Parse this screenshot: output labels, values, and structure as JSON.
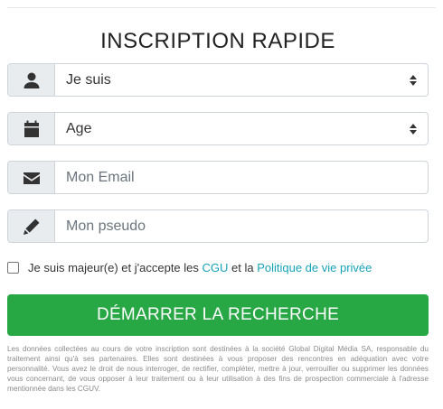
{
  "form": {
    "title": "INSCRIPTION RAPIDE",
    "fields": {
      "gender": {
        "value": "Je suis",
        "icon": "user-icon"
      },
      "age": {
        "value": "Age",
        "icon": "calendar-icon"
      },
      "email": {
        "placeholder": "Mon Email",
        "icon": "envelope-icon"
      },
      "pseudo": {
        "placeholder": "Mon pseudo",
        "icon": "pencil-icon"
      }
    },
    "consent": {
      "text_before": "Je suis majeur(e) et j'accepte les ",
      "cgu_link": "CGU",
      "text_middle": " et la ",
      "privacy_link": "Politique de vie privée",
      "checked": false
    },
    "cta_label": "DÉMARRER LA RECHERCHE",
    "legal_text": "Les données collectées au cours de votre inscription sont destinées à la société Global Digital Média SA, responsable du traitement ainsi qu'à ses partenaires. Elles sont destinées à vous proposer des rencontres en adéquation avec votre personnalité. Vous avez le droit de nous interroger, de rectifier, compléter, mettre à jour, verrouiller ou supprimer les données vous concernant, de vous opposer à leur traitement ou à leur utilisation à des fins de prospection commerciale à l'adresse mentionnée dans les CGUV."
  },
  "colors": {
    "accent_green": "#28a745",
    "link_blue": "#17a2b8",
    "addon_bg": "#e9ecef"
  }
}
